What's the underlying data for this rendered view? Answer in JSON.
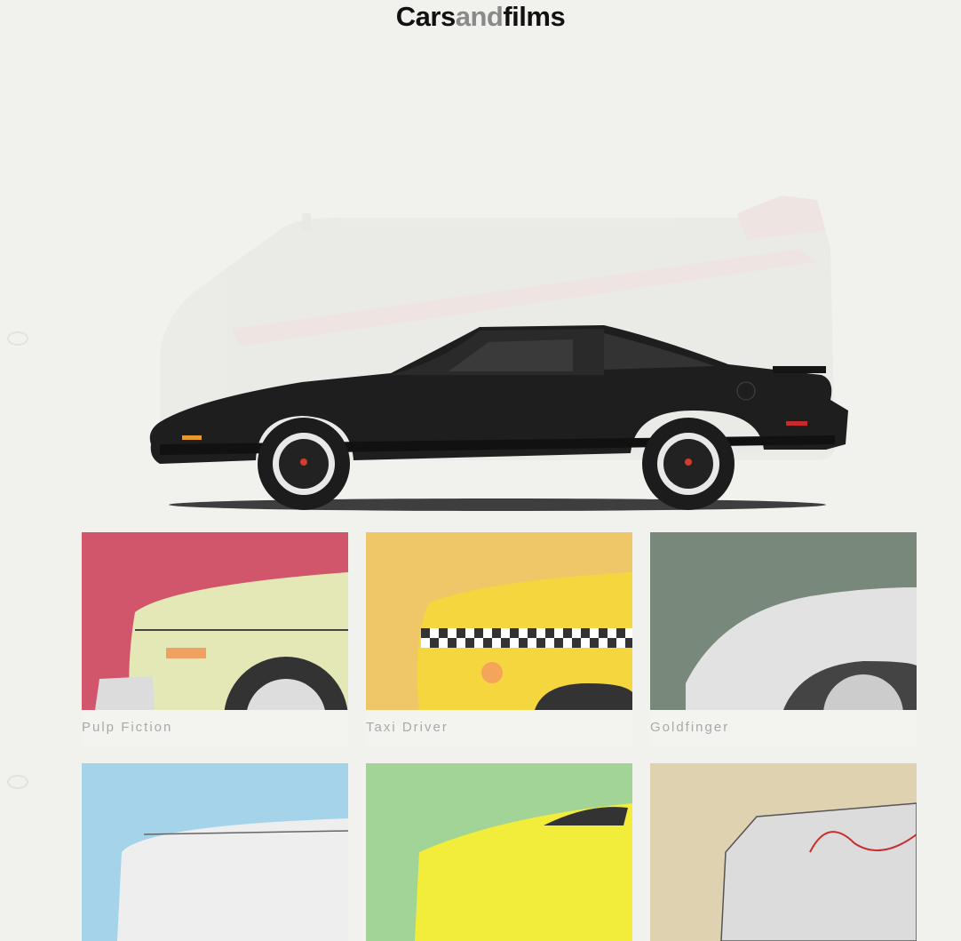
{
  "site": {
    "title_part1": "Cars",
    "title_part2": "and",
    "title_part3": "films",
    "accent_gray": "#8a8a8a"
  },
  "hero": {
    "car": "black-sports-car-illustration",
    "background_car": "faded-van-illustration"
  },
  "gallery": {
    "cards": [
      {
        "caption": "Pulp Fiction",
        "bg": "#d2566b",
        "car_color": "#e4e8b6"
      },
      {
        "caption": "Taxi Driver",
        "bg": "#f0c768",
        "car_color": "#f6d63e"
      },
      {
        "caption": "Goldfinger",
        "bg": "#78887a",
        "car_color": "#e2e2e2"
      },
      {
        "caption": "",
        "bg": "#a5d4ea",
        "car_color": "#eeeeee"
      },
      {
        "caption": "",
        "bg": "#a3d497",
        "car_color": "#f2ec3a"
      },
      {
        "caption": "",
        "bg": "#dfd2b0",
        "car_color": "#dcdcdc"
      }
    ]
  }
}
